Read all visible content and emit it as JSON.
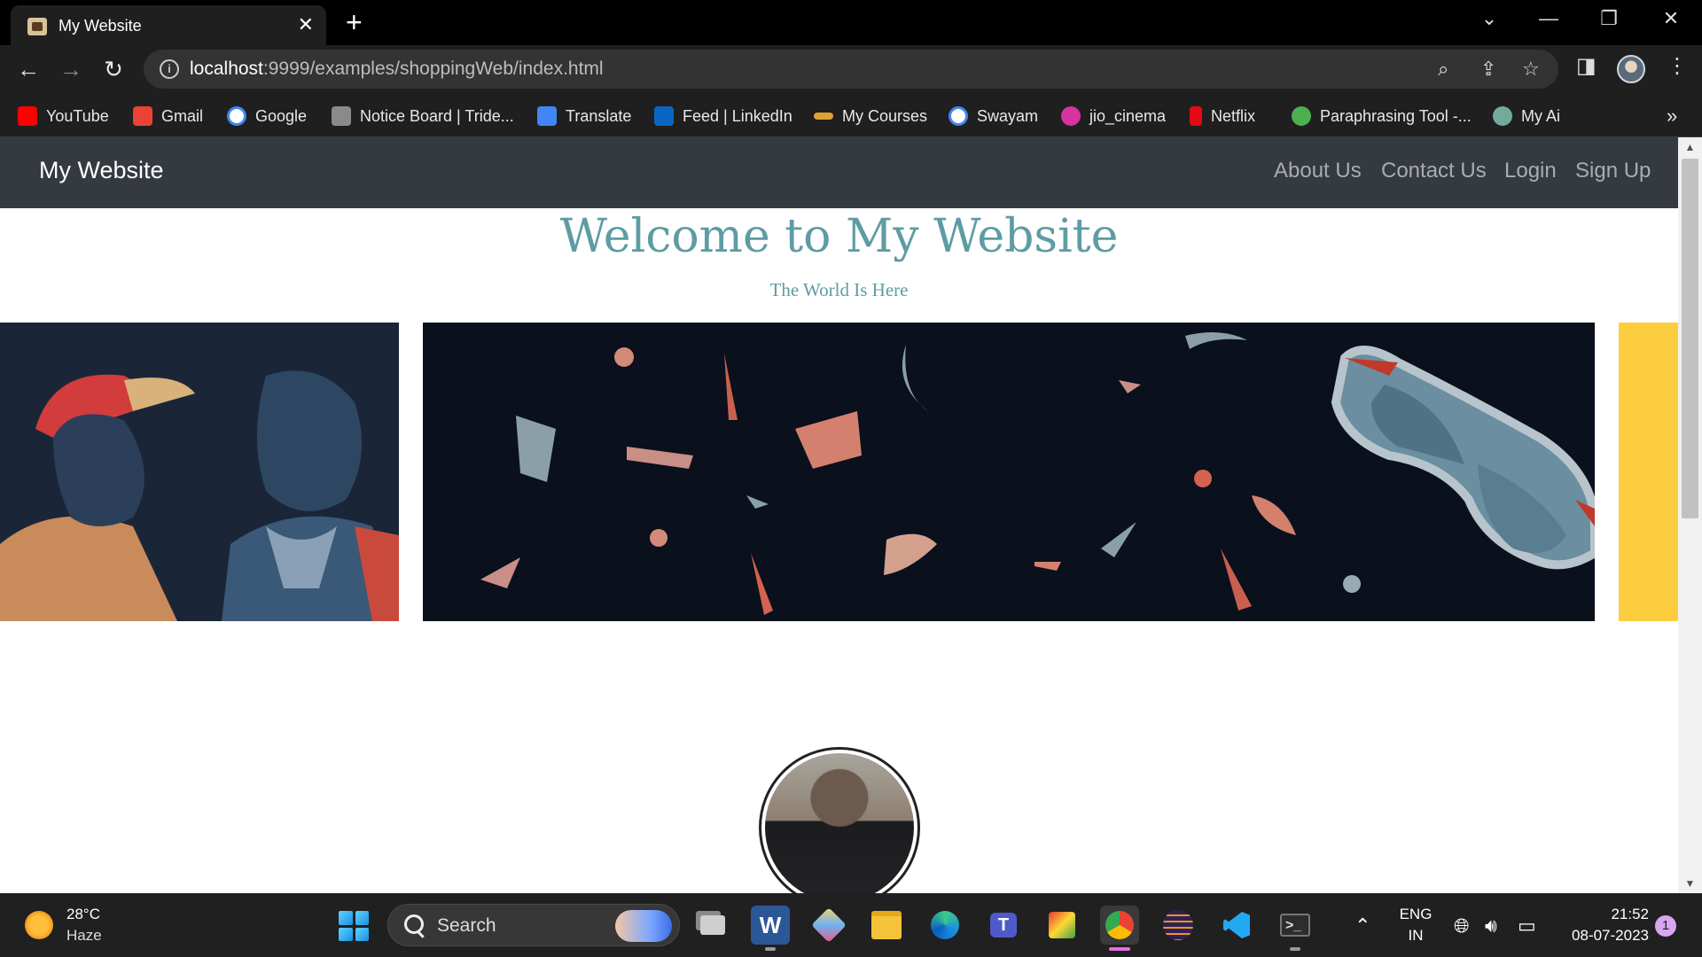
{
  "browser": {
    "tab_title": "My Website",
    "url_host": "localhost",
    "url_rest": ":9999/examples/shoppingWeb/index.html",
    "bookmarks": [
      {
        "label": "YouTube",
        "color": "#ff0000"
      },
      {
        "label": "Gmail",
        "color": "#ea4335"
      },
      {
        "label": "Google",
        "color": "#4285f4"
      },
      {
        "label": "Notice Board | Tride...",
        "color": "#8a8a8a"
      },
      {
        "label": "Translate",
        "color": "#4285f4"
      },
      {
        "label": "Feed | LinkedIn",
        "color": "#0a66c2"
      },
      {
        "label": "My Courses",
        "color": "#e0a030"
      },
      {
        "label": "Swayam",
        "color": "#4285f4"
      },
      {
        "label": "jio_cinema",
        "color": "#d6339c"
      },
      {
        "label": "Netflix",
        "color": "#e50914"
      },
      {
        "label": "Paraphrasing Tool -...",
        "color": "#4caf50"
      },
      {
        "label": "My Ai",
        "color": "#74aa9c"
      }
    ],
    "bookmarks_overflow": "»"
  },
  "site": {
    "brand": "My Website",
    "nav": [
      "About Us",
      "Contact Us",
      "Login",
      "Sign Up"
    ],
    "hero_title": "Welcome to My Website",
    "hero_subtitle": "The World Is Here",
    "accent_color": "#5e9ca4",
    "navbar_color": "#343a40"
  },
  "taskbar": {
    "weather_temp": "28°C",
    "weather_desc": "Haze",
    "search_label": "Search",
    "language_top": "ENG",
    "language_bottom": "IN",
    "time": "21:52",
    "date": "08-07-2023",
    "notification_count": "1"
  }
}
